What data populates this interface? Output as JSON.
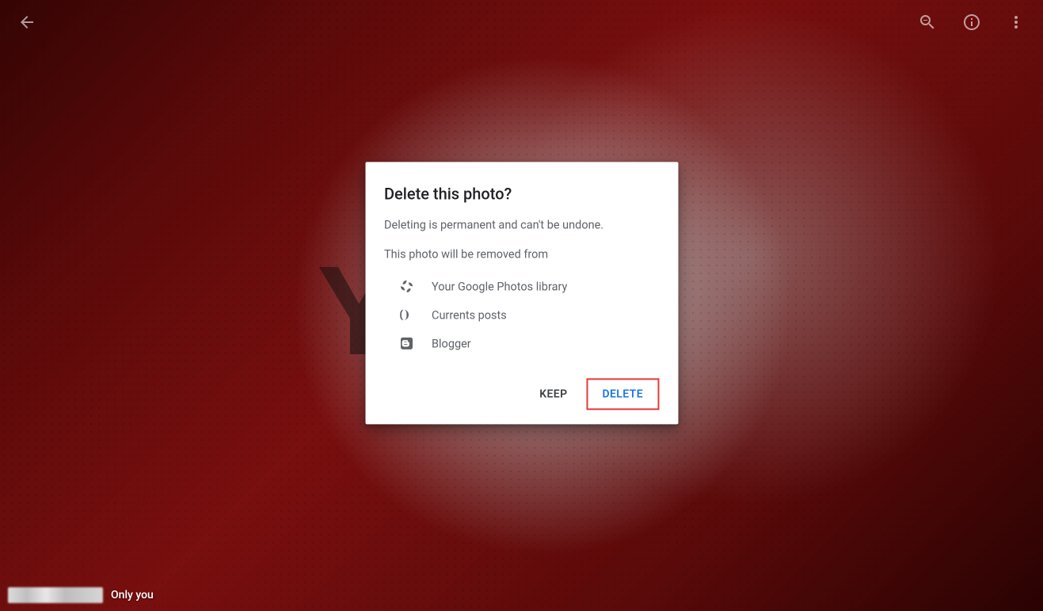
{
  "toolbar": {
    "back": "Back",
    "zoom": "Zoom out",
    "info": "Info",
    "more": "More options"
  },
  "footer": {
    "visibility": "Only you"
  },
  "dialog": {
    "title": "Delete this photo?",
    "warning": "Deleting is permanent and can't be undone.",
    "removed_from_label": "This photo will be removed from",
    "removed_from": [
      {
        "icon": "google-photos-icon",
        "label": "Your Google Photos library"
      },
      {
        "icon": "currents-icon",
        "label": "Currents posts"
      },
      {
        "icon": "blogger-icon",
        "label": "Blogger"
      }
    ],
    "actions": {
      "keep": "KEEP",
      "delete": "DELETE"
    }
  }
}
